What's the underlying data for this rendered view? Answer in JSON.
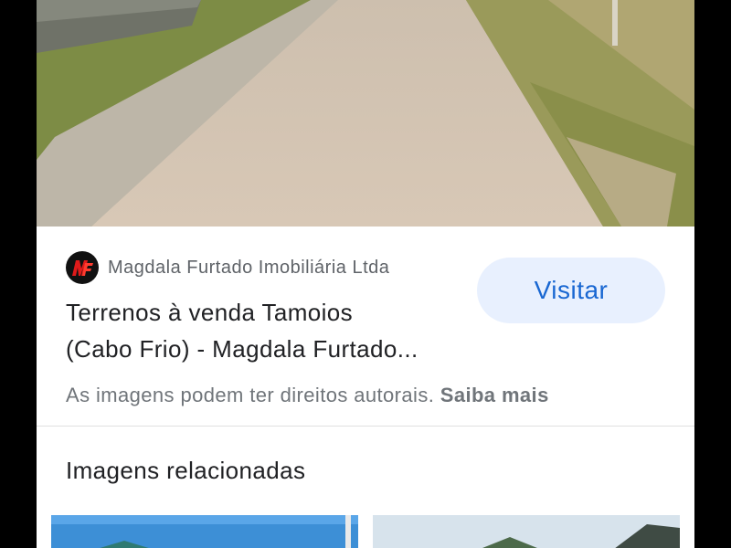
{
  "result": {
    "source": "Magdala Furtado Imobiliária Ltda",
    "title_line1": "Terrenos à venda Tamoios",
    "title_line2": "(Cabo Frio) - Magdala Furtado...",
    "visit_label": "Visitar",
    "copyright_text": "As imagens podem ter direitos autorais.",
    "learn_more": "Saiba mais"
  },
  "related": {
    "heading": "Imagens relacionadas"
  },
  "icons": {
    "source_logo": "magdala-furtado-logo"
  },
  "colors": {
    "accent": "#1967d2",
    "button_bg": "#e8f0fe",
    "logo_red": "#e01a1a"
  }
}
